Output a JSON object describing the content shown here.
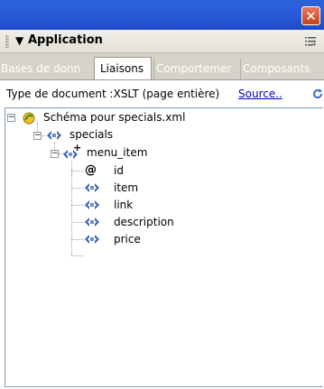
{
  "titlebar": {
    "close_glyph": "✕"
  },
  "panel": {
    "collapse_glyph": "▼",
    "title": "Application"
  },
  "tabs": [
    {
      "label": "Bases de donn",
      "active": false
    },
    {
      "label": "Liaisons",
      "active": true
    },
    {
      "label": "Comportemer",
      "active": false
    },
    {
      "label": "Composants",
      "active": false
    }
  ],
  "doctype": {
    "label": "Type de document :XSLT (page entière)",
    "source_link": "Source..",
    "refresh_icon": "refresh-icon"
  },
  "tree": {
    "root": {
      "label": "Schéma pour specials.xml",
      "expander": "−",
      "icon": "schema-icon"
    },
    "level1": {
      "label": "specials",
      "expander": "−",
      "icon": "element-icon"
    },
    "level2": {
      "label": "menu_item",
      "expander": "−",
      "icon": "repeating-element-icon",
      "badge": "+"
    },
    "attribute": {
      "label": "id",
      "glyph": "@"
    },
    "children": [
      {
        "label": "item"
      },
      {
        "label": "link"
      },
      {
        "label": "description"
      },
      {
        "label": "price"
      }
    ]
  },
  "colors": {
    "titlebar": "#2a5ddc",
    "tab_strip": "#d5d3c8",
    "link": "#0000cc",
    "node_icon": "#3a63b0"
  }
}
